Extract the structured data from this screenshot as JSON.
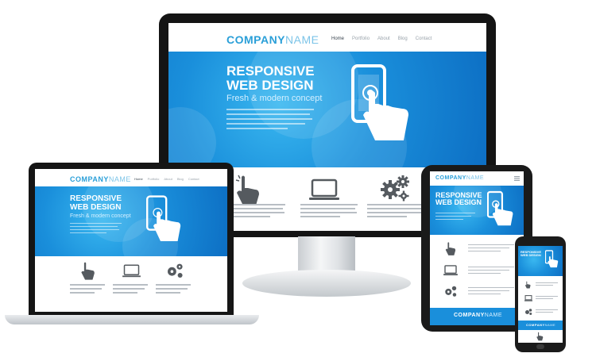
{
  "brand": {
    "part1": "COMPANY",
    "part2": "NAME"
  },
  "nav": {
    "items": [
      "Home",
      "Portfolio",
      "About",
      "Blog",
      "Contact"
    ]
  },
  "hero": {
    "title_line1": "RESPONSIVE",
    "title_line2": "WEB DESIGN",
    "subtitle": "Fresh & modern concept"
  },
  "features": {
    "icons": [
      "hand-pointer-icon",
      "laptop-icon",
      "gears-icon"
    ]
  },
  "colors": {
    "accent": "#2a9fd8",
    "hero_blue": "#1a8fdb",
    "frame": "#141414"
  }
}
